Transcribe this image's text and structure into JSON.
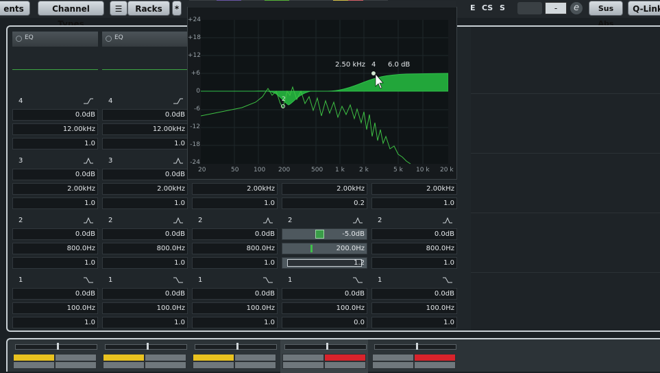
{
  "toolbar": {
    "events_label": "ents",
    "channel_types_label": "Channel Types",
    "racks_label": "Racks",
    "star_label": "*",
    "e_label": "E",
    "cs_label": "CS",
    "s_label": "S",
    "minus_label": "-",
    "e_icon": "e",
    "sus_abs_label": "Sus Abs",
    "qlink_label": "Q-Link"
  },
  "eq_strips": [
    {
      "header": "EQ",
      "band4": {
        "num": "4",
        "gain": "0.0dB",
        "freq": "12.00kHz",
        "q": "1.0"
      },
      "band3": {
        "num": "3",
        "gain": "0.0dB",
        "freq": "2.00kHz",
        "q": "1.0"
      },
      "band2": {
        "num": "2",
        "gain": "0.0dB",
        "freq": "800.0Hz",
        "q": "1.0"
      },
      "band1": {
        "num": "1",
        "gain": "0.0dB",
        "freq": "100.0Hz",
        "q": "1.0"
      }
    },
    {
      "header": "EQ",
      "band4": {
        "num": "4",
        "gain": "0.0dB",
        "freq": "12.00kHz",
        "q": "1.0"
      },
      "band3": {
        "num": "3",
        "gain": "0.0dB",
        "freq": "2.00kHz",
        "q": "1.0"
      },
      "band2": {
        "num": "2",
        "gain": "0.0dB",
        "freq": "800.0Hz",
        "q": "1.0"
      },
      "band1": {
        "num": "1",
        "gain": "0.0dB",
        "freq": "100.0Hz",
        "q": "1.0"
      }
    },
    {
      "band3": {
        "freq": "2.00kHz",
        "q": "1.0"
      },
      "band2": {
        "num": "2",
        "gain": "0.0dB",
        "freq": "800.0Hz",
        "q": "1.0"
      },
      "band1": {
        "num": "1",
        "gain": "0.0dB",
        "freq": "100.0Hz",
        "q": "1.0"
      }
    },
    {
      "band3": {
        "freq": "2.00kHz",
        "q": "0.2"
      },
      "band2": {
        "num": "2",
        "gain": "-5.0dB",
        "freq": "200.0Hz",
        "q": "1.2"
      },
      "band1": {
        "num": "1",
        "gain": "0.0dB",
        "freq": "100.0Hz",
        "q": "0.0"
      }
    },
    {
      "band3": {
        "freq": "2.00kHz",
        "q": "1.0"
      },
      "band2": {
        "num": "2",
        "gain": "0.0dB",
        "freq": "800.0Hz",
        "q": "1.0"
      },
      "band1": {
        "num": "1",
        "gain": "0.0dB",
        "freq": "100.0Hz",
        "q": "1.0"
      }
    }
  ],
  "eq_graph": {
    "y_ticks": [
      "+24",
      "+18",
      "+12",
      "+6",
      "0",
      "-6",
      "-12",
      "-18",
      "-24"
    ],
    "x_ticks": [
      "20",
      "50",
      "100",
      "200",
      "500",
      "1 k",
      "2 k",
      "5 k",
      "10 k",
      "20 k"
    ],
    "tooltip": {
      "freq": "2.50 kHz",
      "band": "4",
      "gain": "6.0 dB"
    },
    "node2_label": "2",
    "curve_color": "#22a63a",
    "spectrum_color": "#3ec244"
  },
  "colors": {
    "accent_yellow": "#e9c21f",
    "accent_red": "#d8232b"
  }
}
